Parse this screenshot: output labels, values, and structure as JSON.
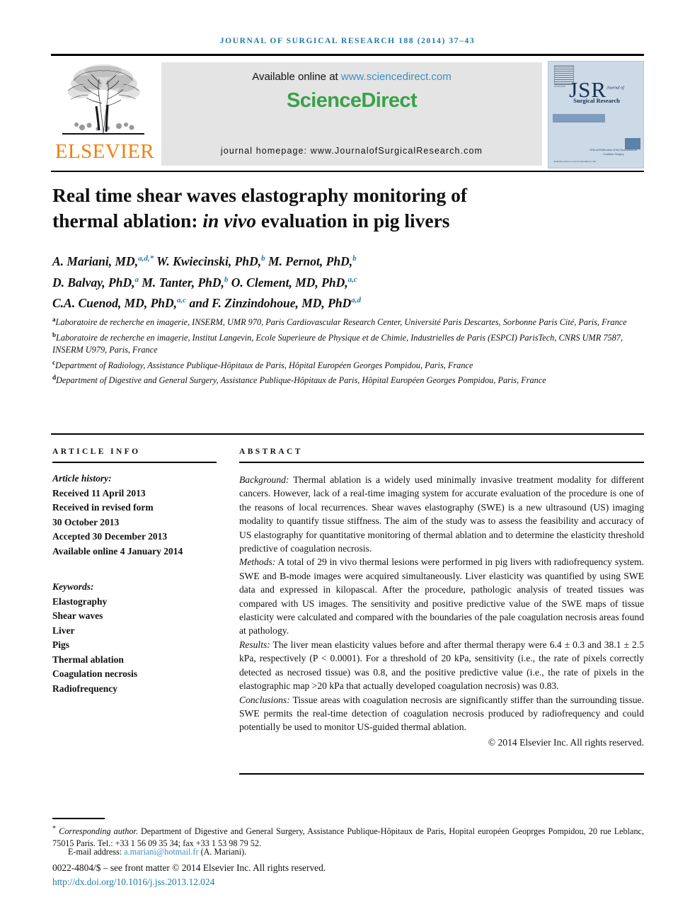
{
  "running_head": "JOURNAL OF SURGICAL RESEARCH 188 (2014) 37–43",
  "masthead": {
    "publisher_name": "ELSEVIER",
    "publisher_logo_alt": "elsevier-tree-logo",
    "available_prefix": "Available online at ",
    "available_link": "www.sciencedirect.com",
    "sciencedirect_logo": "ScienceDirect",
    "journal_homepage": "journal homepage: www.JournalofSurgicalResearch.com",
    "cover": {
      "title_abbr": "JSR",
      "title_sup": "Journal of",
      "subtitle": "Surgical Research",
      "mark_caption": "ELSEVIER",
      "note": "Official Publication of the Association for Academic Surgery",
      "foot": "Available online at www.ScienceDirect.com"
    }
  },
  "article": {
    "title_line1": "Real time shear waves elastography monitoring of",
    "title_line2_pre": "thermal ablation: ",
    "title_line2_italic": "in vivo",
    "title_line2_post": " evaluation in pig livers",
    "authors": [
      {
        "name": "A. Mariani, MD,",
        "sup": "a,d,*"
      },
      {
        "name": "W. Kwiecinski, PhD,",
        "sup": "b"
      },
      {
        "name": "M. Pernot, PhD,",
        "sup": "b"
      },
      {
        "name": "D. Balvay, PhD,",
        "sup": "a"
      },
      {
        "name": "M. Tanter, PhD,",
        "sup": "b"
      },
      {
        "name": "O. Clement, MD, PhD,",
        "sup": "a,c"
      },
      {
        "name": "C.A. Cuenod, MD, PhD,",
        "sup": "a,c"
      },
      {
        "name": "and F. Zinzindohoue, MD, PhD",
        "sup": "a,d"
      }
    ],
    "affiliations": [
      {
        "marker": "a",
        "text": "Laboratoire de recherche en imagerie, INSERM, UMR 970, Paris Cardiovascular Research Center, Université Paris Descartes, Sorbonne Paris Cité, Paris, France"
      },
      {
        "marker": "b",
        "text": "Laboratoire de recherche en imagerie, Institut Langevin, Ecole Superieure de Physique et de Chimie, Industrielles de Paris (ESPCI) ParisTech, CNRS UMR 7587, INSERM U979, Paris, France"
      },
      {
        "marker": "c",
        "text": "Department of Radiology, Assistance Publique-Hôpitaux de Paris, Hôpital Européen Georges Pompidou, Paris, France"
      },
      {
        "marker": "d",
        "text": "Department of Digestive and General Surgery, Assistance Publique-Hôpitaux de Paris, Hôpital Européen Georges Pompidou, Paris, France"
      }
    ]
  },
  "article_info": {
    "heading": "ARTICLE INFO",
    "history_label": "Article history:",
    "history": [
      "Received 11 April 2013",
      "Received in revised form",
      "30 October 2013",
      "Accepted 30 December 2013",
      "Available online 4 January 2014"
    ],
    "keywords_label": "Keywords:",
    "keywords": [
      "Elastography",
      "Shear waves",
      "Liver",
      "Pigs",
      "Thermal ablation",
      "Coagulation necrosis",
      "Radiofrequency"
    ]
  },
  "abstract": {
    "heading": "ABSTRACT",
    "sections": [
      {
        "label": "Background:",
        "text": " Thermal ablation is a widely used minimally invasive treatment modality for different cancers. However, lack of a real-time imaging system for accurate evaluation of the procedure is one of the reasons of local recurrences. Shear waves elastography (SWE) is a new ultrasound (US) imaging modality to quantify tissue stiffness. The aim of the study was to assess the feasibility and accuracy of US elastography for quantitative monitoring of thermal ablation and to determine the elasticity threshold predictive of coagulation necrosis."
      },
      {
        "label": "Methods:",
        "text": " A total of 29 in vivo thermal lesions were performed in pig livers with radiofrequency system. SWE and B-mode images were acquired simultaneously. Liver elasticity was quantified by using SWE data and expressed in kilopascal. After the procedure, pathologic analysis of treated tissues was compared with US images. The sensitivity and positive predictive value of the SWE maps of tissue elasticity were calculated and compared with the boundaries of the pale coagulation necrosis areas found at pathology."
      },
      {
        "label": "Results:",
        "text": " The liver mean elasticity values before and after thermal therapy were 6.4 ± 0.3 and 38.1 ± 2.5 kPa, respectively (P < 0.0001). For a threshold of 20 kPa, sensitivity (i.e., the rate of pixels correctly detected as necrosed tissue) was 0.8, and the positive predictive value (i.e., the rate of pixels in the elastographic map >20 kPa that actually developed coagulation necrosis) was 0.83."
      },
      {
        "label": "Conclusions:",
        "text": " Tissue areas with coagulation necrosis are significantly stiffer than the surrounding tissue. SWE permits the real-time detection of coagulation necrosis produced by radiofrequency and could potentially be used to monitor US-guided thermal ablation."
      }
    ],
    "copyright": "© 2014 Elsevier Inc. All rights reserved."
  },
  "footer": {
    "corresponding_marker": "*",
    "corresponding_label": "Corresponding author.",
    "corresponding_text": " Department of Digestive and General Surgery, Assistance Publique-Hôpitaux de Paris, Hopital européen Geoprges Pompidou, 20 rue Leblanc, 75015 Paris. Tel.: +33 1 56 09 35 34; fax +33 1 53 98 79 52.",
    "email_label": "E-mail address: ",
    "email": "a.mariani@hotmail.fr",
    "email_suffix": " (A. Mariani).",
    "issn_line": "0022-4804/$ – see front matter © 2014 Elsevier Inc. All rights reserved.",
    "doi": "http://dx.doi.org/10.1016/j.jss.2013.12.024"
  },
  "colors": {
    "journal_blue": "#1f7aa8",
    "link_blue": "#3a8fc4",
    "sciencedirect_green": "#3aa148",
    "elsevier_orange": "#f08010",
    "cover_bg": "#ccd9e6"
  }
}
